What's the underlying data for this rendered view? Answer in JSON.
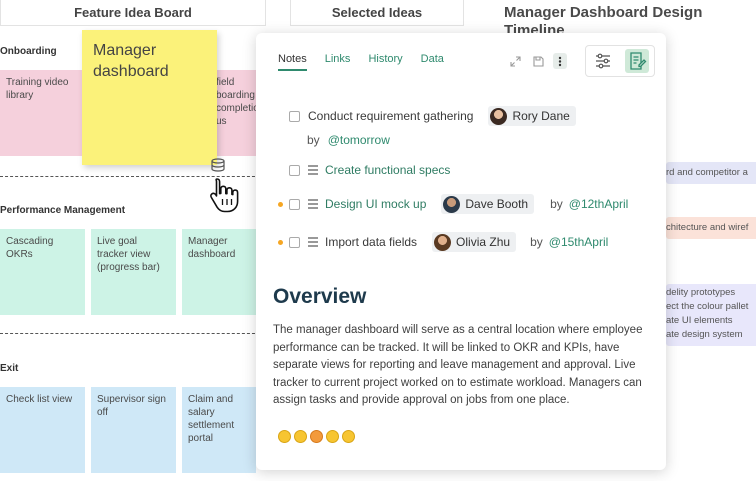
{
  "board": {
    "header_left": "Feature Idea Board",
    "header_mid": "Selected Ideas",
    "right_title": "Manager Dashboard Design Timeline",
    "sections": {
      "onboarding": "Onboarding",
      "performance": "Performance Management",
      "exit": "Exit"
    },
    "stickies": {
      "training": "Training video library",
      "field_onboarding": "field\nboarding\ncompletion\nus",
      "cascading": "Cascading OKRs",
      "live_goal": "Live goal tracker view (progress bar)",
      "manager_dash_small": "Manager dashboard",
      "checklist": "Check list view",
      "supervisor": "Supervisor sign off",
      "claim": "Claim and salary settlement portal"
    },
    "big_sticky": "Manager dashboard",
    "right_cards": {
      "competitor": "rd and competitor a",
      "architecture": "chitecture and wiref",
      "fidelity": "delity prototypes\nect the colour pallet\nate UI elements\nate design system"
    }
  },
  "panel": {
    "tabs": [
      "Notes",
      "Links",
      "History",
      "Data"
    ],
    "active_tab": "Notes",
    "tasks": [
      {
        "label": "Conduct requirement gathering",
        "assignee": "Rory Dane",
        "by": "by",
        "due": "@tomorrow"
      },
      {
        "label": "Create functional specs"
      },
      {
        "label": "Design UI mock up",
        "assignee": "Dave Booth",
        "by": "by",
        "due": "@12thApril"
      },
      {
        "label": "Import data fields",
        "assignee": "Olivia Zhu",
        "by": "by",
        "due": "@15thApril"
      }
    ],
    "overview_title": "Overview",
    "overview_body": "The manager dashboard will serve as a central location where employee performance can be tracked. It will be linked to OKR and KPIs, have separate views for reporting and leave management and approval.  Live tracker to current project worked on to estimate workload. Managers can assign tasks and provide approval on jobs from one place.",
    "emojis": [
      "grinning-emoji",
      "laughing-emoji",
      "angry-emoji",
      "halo-emoji",
      "thinking-emoji"
    ]
  },
  "colors": {
    "accent": "#2f8a6e",
    "yellow_sticky": "#fbf27a",
    "pink_sticky": "#f5d0dc",
    "mint_sticky": "#cdf3e6",
    "blue_sticky": "#cfe8f7",
    "overview_heading": "#1e3a4c",
    "priority_dot": "#f5a623"
  }
}
